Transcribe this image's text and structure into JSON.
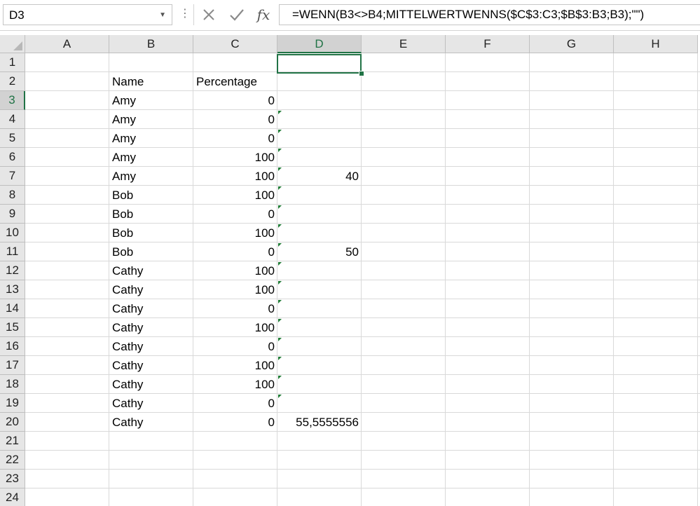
{
  "formula_bar": {
    "name_box": "D3",
    "formula": "=WENN(B3<>B4;MITTELWERTWENNS($C$3:C3;$B$3:B3;B3);\"\")",
    "icons": [
      "more-options-icon",
      "cancel-icon",
      "enter-check-icon",
      "fx-icon",
      "chevron-down-icon"
    ]
  },
  "columns": [
    "A",
    "B",
    "C",
    "D",
    "E",
    "F",
    "G",
    "H"
  ],
  "selected_column": "D",
  "rows": [
    "1",
    "2",
    "3",
    "4",
    "5",
    "6",
    "7",
    "8",
    "9",
    "10",
    "11",
    "12",
    "13",
    "14",
    "15",
    "16",
    "17",
    "18",
    "19",
    "20",
    "21",
    "22",
    "23",
    "24"
  ],
  "selected_row": "3",
  "headers": {
    "name": "Name",
    "percentage": "Percentage"
  },
  "data_rows": [
    {
      "row": "3",
      "name": "Amy",
      "pct": "0",
      "avg": ""
    },
    {
      "row": "4",
      "name": "Amy",
      "pct": "0",
      "avg": ""
    },
    {
      "row": "5",
      "name": "Amy",
      "pct": "0",
      "avg": ""
    },
    {
      "row": "6",
      "name": "Amy",
      "pct": "100",
      "avg": ""
    },
    {
      "row": "7",
      "name": "Amy",
      "pct": "100",
      "avg": "40"
    },
    {
      "row": "8",
      "name": "Bob",
      "pct": "100",
      "avg": ""
    },
    {
      "row": "9",
      "name": "Bob",
      "pct": "0",
      "avg": ""
    },
    {
      "row": "10",
      "name": "Bob",
      "pct": "100",
      "avg": ""
    },
    {
      "row": "11",
      "name": "Bob",
      "pct": "0",
      "avg": "50"
    },
    {
      "row": "12",
      "name": "Cathy",
      "pct": "100",
      "avg": ""
    },
    {
      "row": "13",
      "name": "Cathy",
      "pct": "100",
      "avg": ""
    },
    {
      "row": "14",
      "name": "Cathy",
      "pct": "0",
      "avg": ""
    },
    {
      "row": "15",
      "name": "Cathy",
      "pct": "100",
      "avg": ""
    },
    {
      "row": "16",
      "name": "Cathy",
      "pct": "0",
      "avg": ""
    },
    {
      "row": "17",
      "name": "Cathy",
      "pct": "100",
      "avg": ""
    },
    {
      "row": "18",
      "name": "Cathy",
      "pct": "100",
      "avg": ""
    },
    {
      "row": "19",
      "name": "Cathy",
      "pct": "0",
      "avg": ""
    },
    {
      "row": "20",
      "name": "Cathy",
      "pct": "0",
      "avg": "55,5555556"
    }
  ],
  "accent_color": "#217346"
}
